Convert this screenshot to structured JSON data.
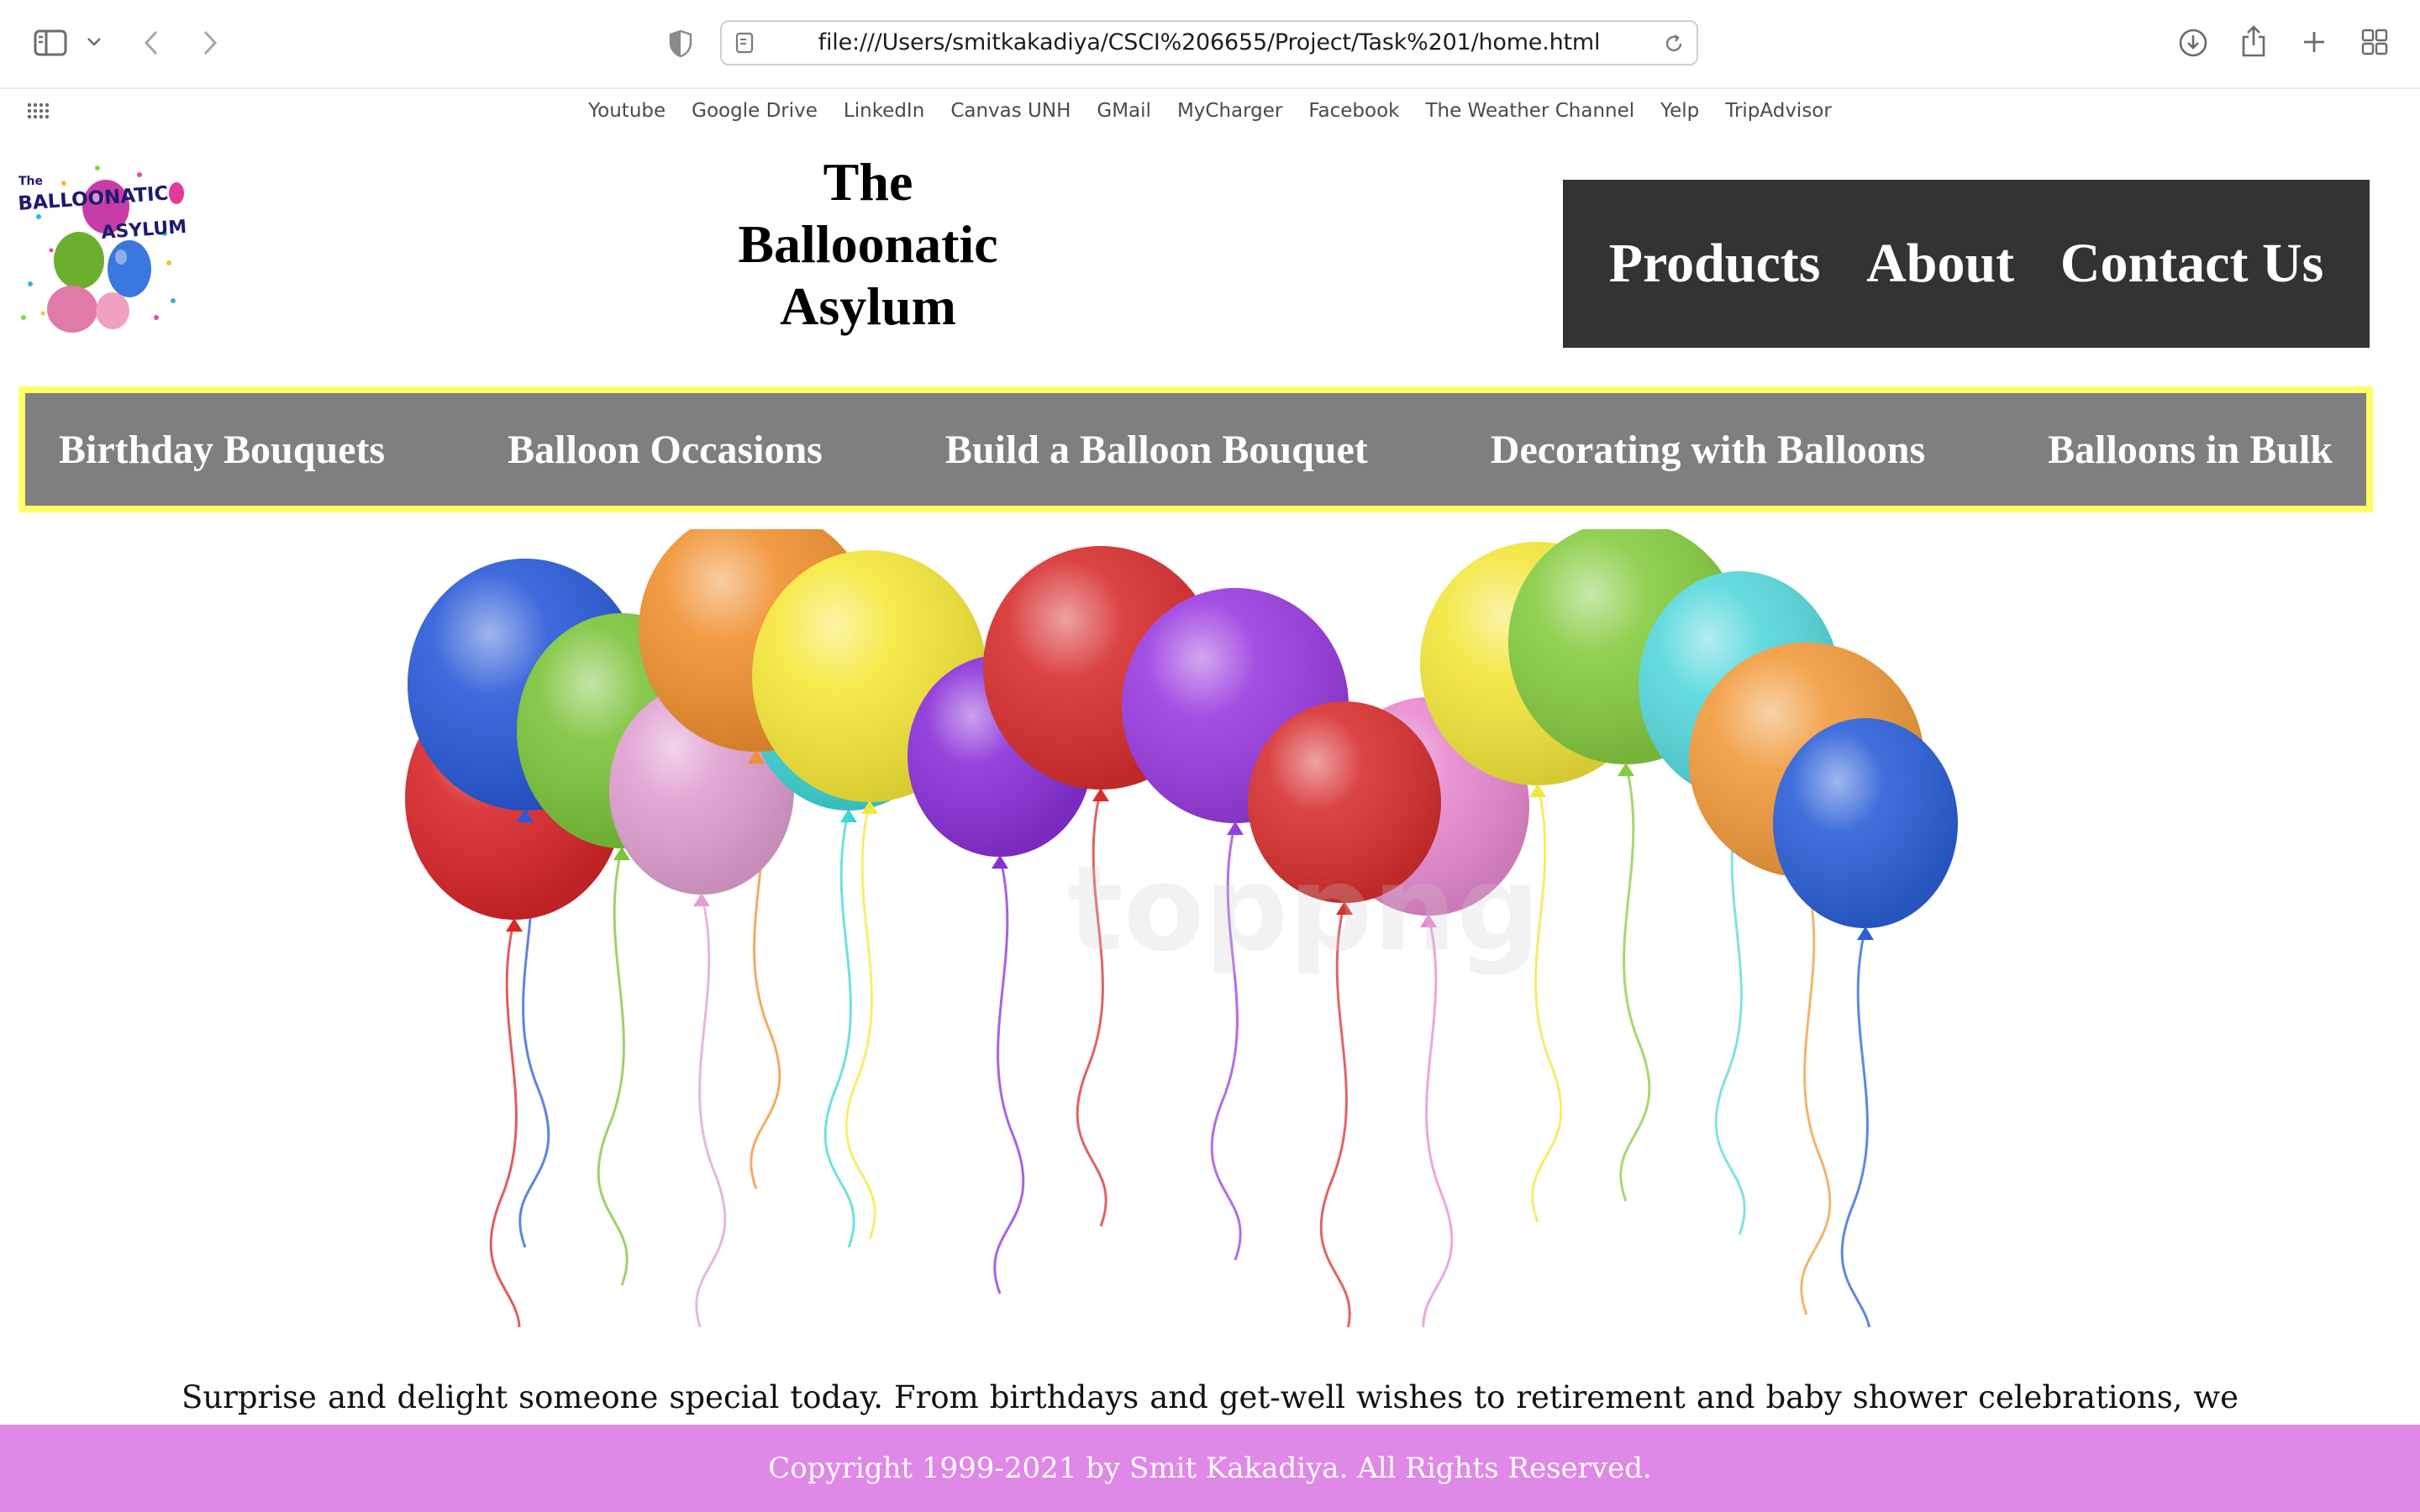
{
  "browser": {
    "url": "file:///Users/smitkakadiya/CSCI%206655/Project/Task%201/home.html",
    "favorites": [
      "Youtube",
      "Google Drive",
      "LinkedIn",
      "Canvas UNH",
      "GMail",
      "MyCharger",
      "Facebook",
      "The Weather Channel",
      "Yelp",
      "TripAdvisor"
    ],
    "icons": [
      "sidebar-icon",
      "chevron-down-icon",
      "back-icon",
      "forward-icon",
      "shield-icon",
      "page-icon",
      "reload-icon",
      "download-icon",
      "share-icon",
      "plus-icon",
      "tabs-grid-icon",
      "apps-grid-icon"
    ]
  },
  "header": {
    "logo_text": [
      "The",
      "BALLOONATIC",
      "ASYLUM"
    ],
    "title": "The Balloonatic Asylum"
  },
  "top_nav": {
    "products": "Products",
    "about": "About",
    "contact": "Contact Us"
  },
  "category_nav": {
    "items": [
      "Birthday Bouquets",
      "Balloon Occasions",
      "Build a Balloon Bouquet",
      "Decorating with Balloons",
      "Balloons in Bulk"
    ]
  },
  "hero": {
    "watermark": "toppng",
    "balloon_colors": [
      "#d8262a",
      "#2a5ad8",
      "#7cc43a",
      "#e0a0d0",
      "#3fd6d6",
      "#f09030",
      "#f6e83a",
      "#8a30d8",
      "#d82e2e",
      "#e88ad0",
      "#9a3ce0",
      "#f3e63a",
      "#d83030",
      "#85cc40",
      "#56d8dc",
      "#f19a3c",
      "#2c60d8"
    ]
  },
  "intro_text": "Surprise and delight someone special today. From birthdays and get-well wishes to retirement and baby shower celebrations, we offer balloon designs for practically any occasion. Customize the hues and even add an own touch! We recognize that YOUR event is significant.",
  "footer": {
    "text": "Copyright 1999-2021 by Smit Kakadiya. All Rights Reserved."
  },
  "colors": {
    "top_nav_bg": "#333333",
    "category_nav_bg": "#7f7f7f",
    "category_nav_border": "#ffff66",
    "footer_bg": "#e088e8"
  }
}
